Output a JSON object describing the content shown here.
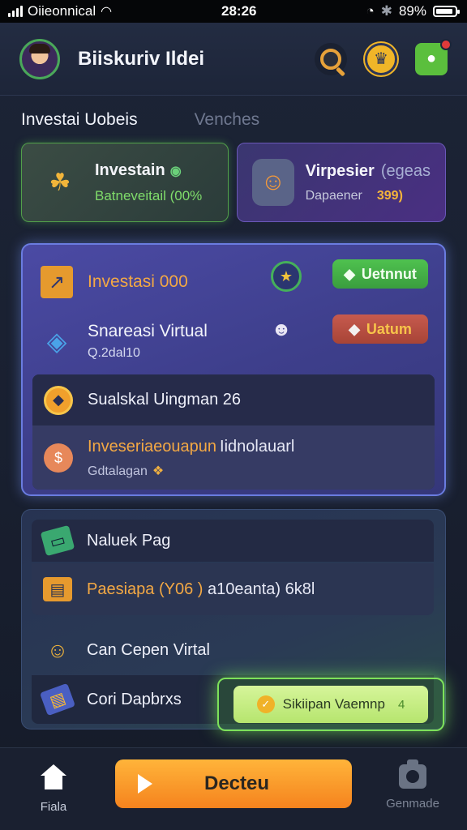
{
  "status_bar": {
    "carrier": "Oiieonnical",
    "time": "28:26",
    "battery": "89%"
  },
  "header": {
    "title": "Biiskuriv Ildei"
  },
  "tabs": [
    {
      "label": "Investai Uobeis"
    },
    {
      "label": "Venches"
    }
  ],
  "cards": {
    "invest": {
      "title": "Investain",
      "sub": "Batneveitail (00%"
    },
    "virtual": {
      "title": "Virpesier",
      "title_extra": "(egeas",
      "sub": "Dapaener",
      "value": "399)"
    }
  },
  "main_panel": {
    "row1": {
      "title": "Investasi 000",
      "button": "Uetnnut"
    },
    "row2": {
      "title": "Snareasi Virtual",
      "sub": "Q.2dal10",
      "button": "Uatum"
    },
    "list": [
      {
        "title": "Sualskal Uingman 26"
      },
      {
        "title": "Inveseriaeouapun",
        "title_rest": "Iidnolauarl",
        "sub": "Gdtalagan"
      }
    ]
  },
  "second_panel": {
    "items": [
      {
        "title": "Naluek Pag"
      },
      {
        "title": "Paesiapa (Y06 )",
        "title_rest": "a10eanta) 6k8l"
      },
      {
        "title": "Can Cepen Virtal"
      },
      {
        "title": "Cori Dapbrxs"
      }
    ]
  },
  "cta": {
    "label": "Sikiipan Vaemnp",
    "count": "4"
  },
  "bottom_nav": {
    "home_label": "Fiala",
    "primary_label": "Decteu",
    "right_label": "Genmade"
  },
  "colors": {
    "accent_green": "#5bbf3d",
    "accent_orange": "#f5831e",
    "panel_purple": "#4b4aa4",
    "gold": "#f3a844"
  }
}
